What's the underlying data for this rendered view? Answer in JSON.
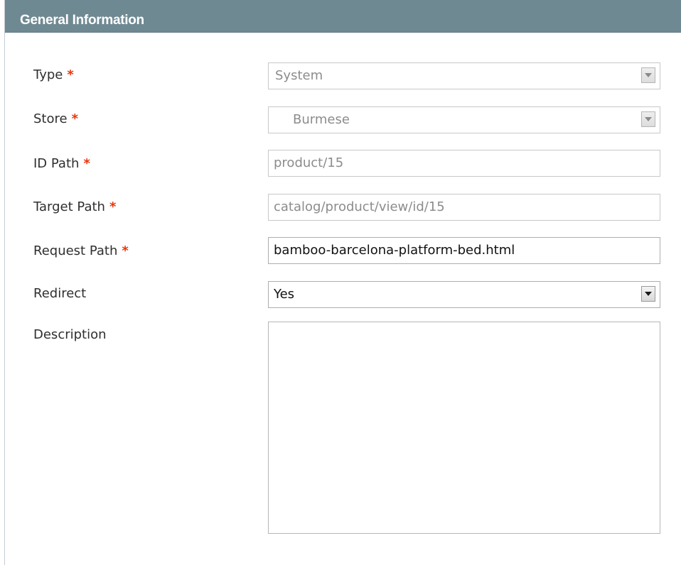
{
  "panel": {
    "title": "General Information"
  },
  "form": {
    "required_mark": "*",
    "type": {
      "label": "Type",
      "value": "System",
      "required": true
    },
    "store": {
      "label": "Store",
      "value": "Burmese",
      "required": true
    },
    "id_path": {
      "label": "ID Path",
      "value": "product/15",
      "required": true
    },
    "target_path": {
      "label": "Target Path",
      "value": "catalog/product/view/id/15",
      "required": true
    },
    "request_path": {
      "label": "Request Path",
      "value": "bamboo-barcelona-platform-bed.html",
      "required": true
    },
    "redirect": {
      "label": "Redirect",
      "value": "Yes",
      "required": false
    },
    "description": {
      "label": "Description",
      "value": "",
      "required": false
    }
  },
  "colors": {
    "header_bg": "#6f8992",
    "required_mark": "#eb340a",
    "disabled_text": "#8c8c8c"
  },
  "icons": {
    "select_arrow": "chevron-down-icon"
  }
}
